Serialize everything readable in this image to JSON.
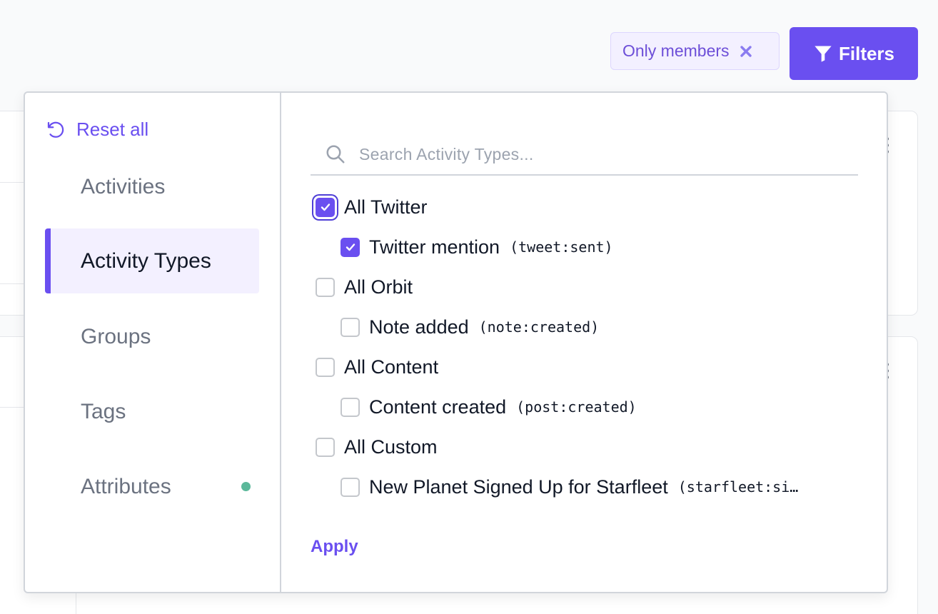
{
  "topbar": {
    "chip_label": "Only members",
    "filters_label": "Filters"
  },
  "panel": {
    "reset_label": "Reset all",
    "nav": [
      {
        "label": "Activities",
        "active": false
      },
      {
        "label": "Activity Types",
        "active": true
      },
      {
        "label": "Groups",
        "active": false
      },
      {
        "label": "Tags",
        "active": false
      },
      {
        "label": "Attributes",
        "active": false,
        "indicator": true
      }
    ],
    "search_placeholder": "Search Activity Types...",
    "options": [
      {
        "label": "All Twitter",
        "code": "",
        "checked": true,
        "level": 0
      },
      {
        "label": "Twitter mention",
        "code": "(tweet:sent)",
        "checked": true,
        "level": 1
      },
      {
        "label": "All Orbit",
        "code": "",
        "checked": false,
        "level": 0
      },
      {
        "label": "Note added",
        "code": "(note:created)",
        "checked": false,
        "level": 1
      },
      {
        "label": "All Content",
        "code": "",
        "checked": false,
        "level": 0
      },
      {
        "label": "Content created",
        "code": "(post:created)",
        "checked": false,
        "level": 1
      },
      {
        "label": "All Custom",
        "code": "",
        "checked": false,
        "level": 0
      },
      {
        "label": "New Planet Signed Up for Starfleet",
        "code": "(starfleet:si…",
        "checked": false,
        "level": 1
      }
    ],
    "apply_label": "Apply"
  },
  "colors": {
    "accent": "#6a4ff0",
    "indicator": "#5bb89a"
  }
}
